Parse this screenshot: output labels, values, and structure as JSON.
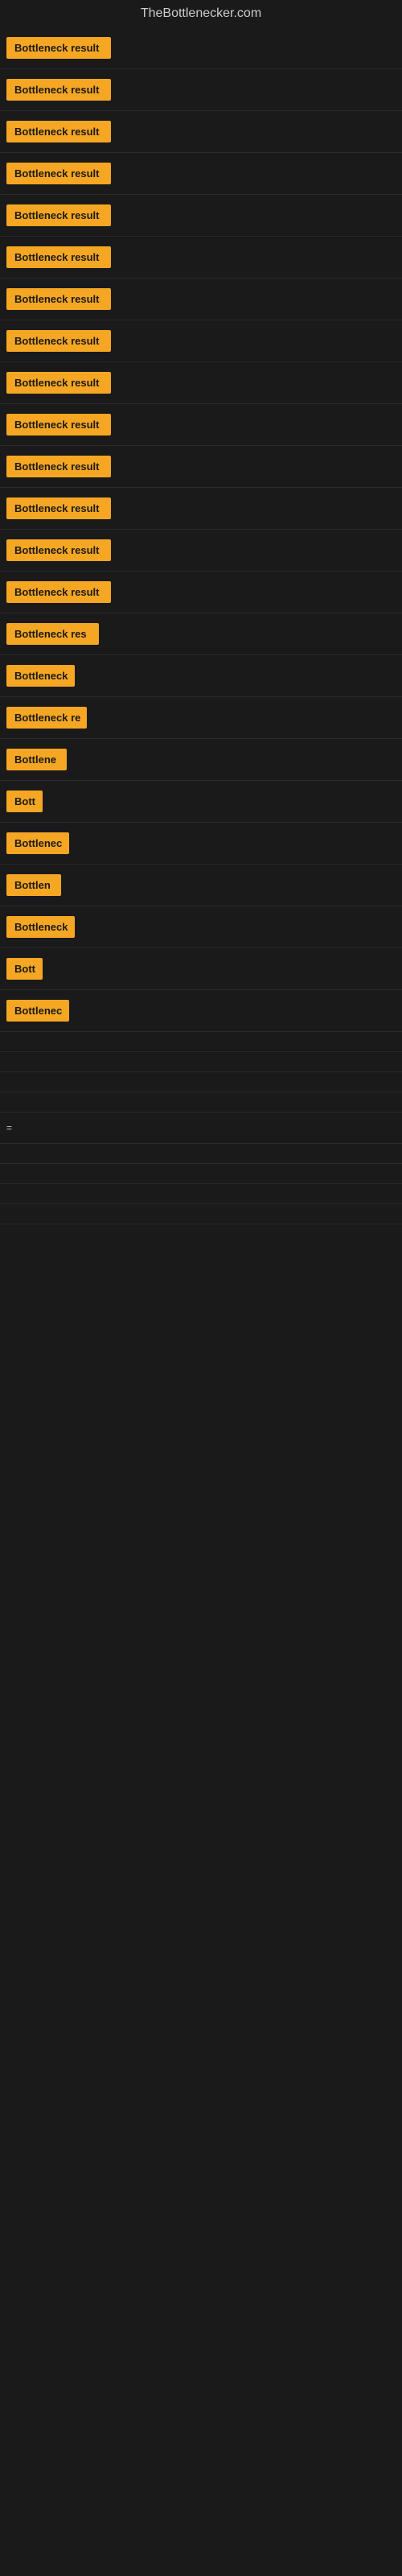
{
  "header": {
    "title": "TheBottlenecker.com"
  },
  "items": [
    {
      "label": "Bottleneck result",
      "width": 130
    },
    {
      "label": "Bottleneck result",
      "width": 130
    },
    {
      "label": "Bottleneck result",
      "width": 130
    },
    {
      "label": "Bottleneck result",
      "width": 130
    },
    {
      "label": "Bottleneck result",
      "width": 130
    },
    {
      "label": "Bottleneck result",
      "width": 130
    },
    {
      "label": "Bottleneck result",
      "width": 130
    },
    {
      "label": "Bottleneck result",
      "width": 130
    },
    {
      "label": "Bottleneck result",
      "width": 130
    },
    {
      "label": "Bottleneck result",
      "width": 130
    },
    {
      "label": "Bottleneck result",
      "width": 130
    },
    {
      "label": "Bottleneck result",
      "width": 130
    },
    {
      "label": "Bottleneck result",
      "width": 130
    },
    {
      "label": "Bottleneck result",
      "width": 130
    },
    {
      "label": "Bottleneck res",
      "width": 115
    },
    {
      "label": "Bottleneck",
      "width": 85
    },
    {
      "label": "Bottleneck re",
      "width": 100
    },
    {
      "label": "Bottlene",
      "width": 75
    },
    {
      "label": "Bott",
      "width": 45
    },
    {
      "label": "Bottlenec",
      "width": 78
    },
    {
      "label": "Bottlen",
      "width": 68
    },
    {
      "label": "Bottleneck",
      "width": 85
    },
    {
      "label": "Bott",
      "width": 45
    },
    {
      "label": "Bottlenec",
      "width": 78
    },
    {
      "label": "",
      "width": 0
    },
    {
      "label": "",
      "width": 0
    },
    {
      "label": "",
      "width": 0
    },
    {
      "label": "",
      "width": 0
    },
    {
      "label": "=",
      "width": 12
    },
    {
      "label": "",
      "width": 0
    },
    {
      "label": "",
      "width": 0
    },
    {
      "label": "",
      "width": 0
    },
    {
      "label": "",
      "width": 0
    }
  ],
  "colors": {
    "accent": "#f5a623",
    "background": "#1a1a1a",
    "text": "#cccccc"
  }
}
